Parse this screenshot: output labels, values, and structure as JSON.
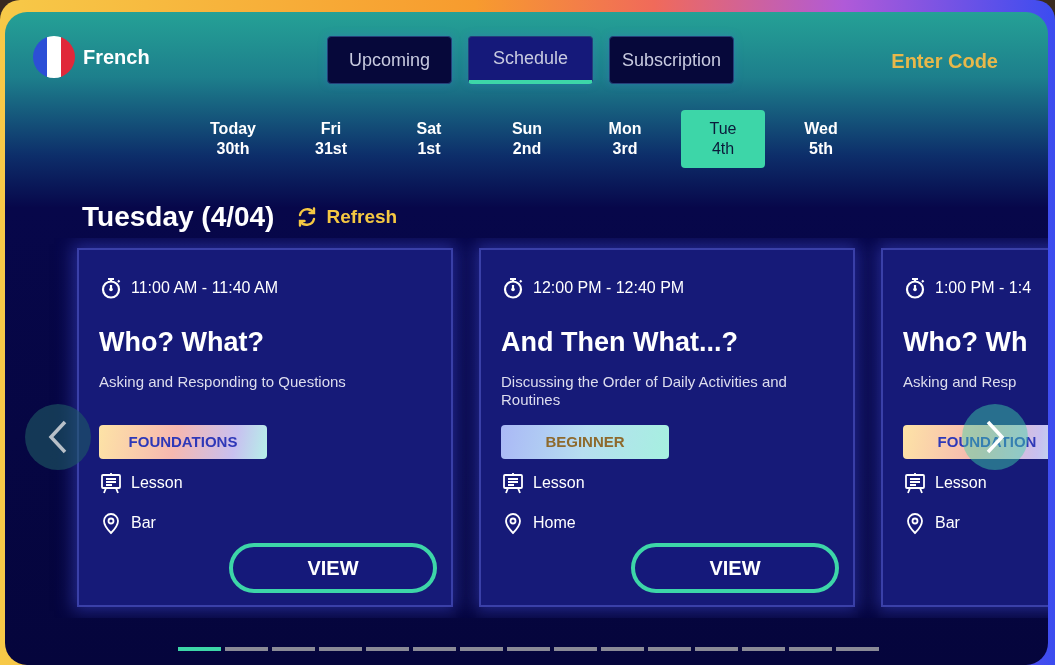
{
  "language": {
    "name": "French"
  },
  "tabs": [
    {
      "label": "Upcoming",
      "selected": false
    },
    {
      "label": "Schedule",
      "selected": true
    },
    {
      "label": "Subscription",
      "selected": false
    }
  ],
  "enter_code": "Enter Code",
  "days": [
    {
      "weekday": "Today",
      "date": "30th",
      "selected": false
    },
    {
      "weekday": "Fri",
      "date": "31st",
      "selected": false
    },
    {
      "weekday": "Sat",
      "date": "1st",
      "selected": false
    },
    {
      "weekday": "Sun",
      "date": "2nd",
      "selected": false
    },
    {
      "weekday": "Mon",
      "date": "3rd",
      "selected": false
    },
    {
      "weekday": "Tue",
      "date": "4th",
      "selected": true
    },
    {
      "weekday": "Wed",
      "date": "5th",
      "selected": false
    }
  ],
  "day_heading": "Tuesday (4/04)",
  "refresh": "Refresh",
  "sessions": [
    {
      "time": "11:00 AM - 11:40 AM",
      "title": "Who? What?",
      "subtitle": "Asking and Responding to Questions",
      "badge": {
        "text": "FOUNDATIONS",
        "kind": "foundations"
      },
      "type": "Lesson",
      "place": "Bar",
      "button": "VIEW"
    },
    {
      "time": "12:00 PM - 12:40 PM",
      "title": "And Then What...?",
      "subtitle": "Discussing the Order of Daily Activities and Routines",
      "badge": {
        "text": "BEGINNER",
        "kind": "beginner"
      },
      "type": "Lesson",
      "place": "Home",
      "button": "VIEW"
    },
    {
      "time": "1:00 PM - 1:4",
      "title": "Who? Wh",
      "subtitle": "Asking and Resp",
      "badge": {
        "text": "FOUNDATION",
        "kind": "foundations"
      },
      "type": "Lesson",
      "place": "Bar"
    }
  ],
  "pager": [
    {
      "selected": true
    },
    {
      "selected": false
    },
    {
      "selected": false
    },
    {
      "selected": false
    },
    {
      "selected": false
    },
    {
      "selected": false
    },
    {
      "selected": false
    },
    {
      "selected": false
    },
    {
      "selected": false
    },
    {
      "selected": false
    },
    {
      "selected": false
    },
    {
      "selected": false
    },
    {
      "selected": false
    },
    {
      "selected": false
    },
    {
      "selected": false
    }
  ]
}
